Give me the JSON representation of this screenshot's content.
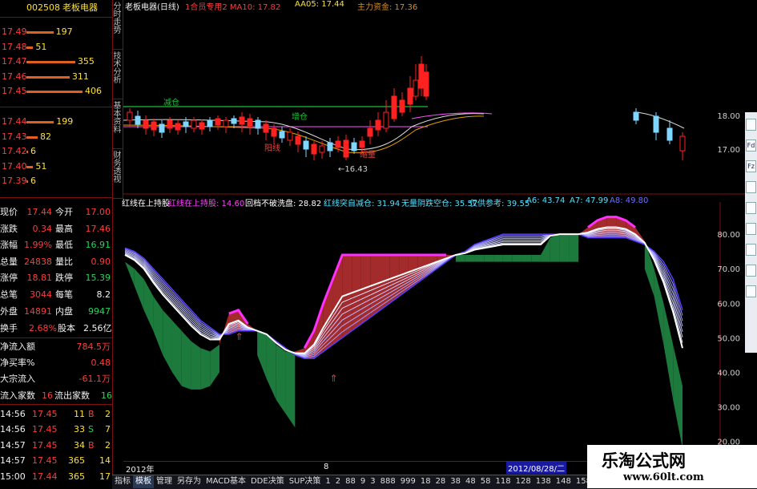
{
  "stock": {
    "code": "002508",
    "name": "老板电器"
  },
  "asks": [
    {
      "price": "17.49",
      "vol": "197",
      "bar": 0.48
    },
    {
      "price": "17.48",
      "vol": "51",
      "bar": 0.12
    },
    {
      "price": "17.47",
      "vol": "355",
      "bar": 0.87
    },
    {
      "price": "17.46",
      "vol": "311",
      "bar": 0.77
    },
    {
      "price": "17.45",
      "vol": "406",
      "bar": 1.0
    }
  ],
  "bids": [
    {
      "price": "17.44",
      "vol": "199",
      "bar": 0.49
    },
    {
      "price": "17.43",
      "vol": "82",
      "bar": 0.2
    },
    {
      "price": "17.42",
      "vol": "6",
      "bar": 0.02
    },
    {
      "price": "17.40",
      "vol": "51",
      "bar": 0.12
    },
    {
      "price": "17.39",
      "vol": "6",
      "bar": 0.02
    }
  ],
  "quote": [
    [
      "现价",
      "17.44",
      "今开",
      "17.00"
    ],
    [
      "涨跌",
      "0.34",
      "最高",
      "17.46"
    ],
    [
      "涨幅",
      "1.99%",
      "最低",
      "16.91"
    ],
    [
      "总量",
      "24838",
      "量比",
      "0.90"
    ],
    [
      "涨停",
      "18.81",
      "跌停",
      "15.39"
    ],
    [
      "总笔",
      "3044",
      "每笔",
      "8.2"
    ],
    [
      "外盘",
      "14891",
      "内盘",
      "9947"
    ]
  ],
  "turnover": {
    "l1": "换手",
    "v1": "2.68%",
    "l2": "股本",
    "v2": "2.56亿"
  },
  "flow": [
    {
      "label": "净流入额",
      "value": "784.5万"
    },
    {
      "label": "净买率%",
      "value": "0.48"
    },
    {
      "label": "大宗流入",
      "value": "-61.1万"
    }
  ],
  "counts": {
    "in_label": "流入家数",
    "in_val": "16",
    "out_label": "流出家数",
    "out_val": "16"
  },
  "ticks": [
    {
      "time": "14:56",
      "price": "17.45",
      "vol": "11",
      "side": "B",
      "n": "2"
    },
    {
      "time": "14:56",
      "price": "17.45",
      "vol": "33",
      "side": "S",
      "n": "7"
    },
    {
      "time": "14:57",
      "price": "17.45",
      "vol": "34",
      "side": "B",
      "n": "2"
    },
    {
      "time": "14:57",
      "price": "17.45",
      "vol": "365",
      "side": "",
      "n": "14"
    },
    {
      "time": "15:00",
      "price": "17.44",
      "vol": "365",
      "side": "",
      "n": "17"
    }
  ],
  "vtabs": [
    "分时走势",
    "技术分析",
    "基本资料",
    "财务透视"
  ],
  "main_header": {
    "title": "老板电器(日线)",
    "t1": "1合员专用2 MA10: 17.82",
    "t2": "AA05: 17.44",
    "t3": "主力资金: 17.36"
  },
  "main_labels": {
    "reduce": "减仓",
    "add": "增仓",
    "up_k": "阳线",
    "low": "16.43",
    "low2": "缩量",
    "ytick1": "18.00",
    "ytick2": "17.00"
  },
  "osc_header": [
    {
      "text": "红线在上持股",
      "color": "#ffffff"
    },
    {
      "text": "红线在上持股: 14.60",
      "color": "#ff40ff"
    },
    {
      "text": "回档不破洗盘: 28.82",
      "color": "#ffffff"
    },
    {
      "text": "红线突自减仓: 31.94",
      "color": "#56e0ff"
    },
    {
      "text": "无量阴跌空仓: 35.57",
      "color": "#56e0ff"
    },
    {
      "text": "仅供参考: 39.55",
      "color": "#56e0ff"
    },
    {
      "text": "A6: 43.74",
      "color": "#56e0ff"
    },
    {
      "text": "A7: 47.99",
      "color": "#56e0ff"
    },
    {
      "text": "A8: 49.80",
      "color": "#7070ff"
    }
  ],
  "osc_axis": [
    "80.00",
    "70.00",
    "60.00",
    "50.00",
    "40.00",
    "30.00",
    "20.00"
  ],
  "chart_data": {
    "type": "area",
    "ylim": [
      15,
      87
    ],
    "yticks": [
      80,
      70,
      60,
      50,
      40,
      30,
      20
    ],
    "x": [
      0,
      1,
      2,
      3,
      4,
      5,
      6,
      7,
      8,
      9,
      10,
      11,
      12,
      13,
      14,
      15,
      16,
      17,
      18,
      19,
      20,
      21,
      22,
      23,
      24,
      25,
      26,
      27,
      28,
      29,
      30,
      31,
      32,
      33,
      34,
      35,
      36,
      37,
      38,
      39,
      40,
      41,
      42,
      43,
      44,
      45,
      46,
      47,
      48,
      49,
      50,
      51,
      52,
      53,
      54,
      55,
      56,
      57,
      58,
      59
    ],
    "fast": [
      72,
      70,
      67,
      62,
      58,
      55,
      52,
      49,
      47,
      46,
      48,
      57,
      58,
      54,
      52,
      51,
      48,
      46,
      46,
      47,
      52,
      60,
      67,
      74,
      74,
      74,
      74,
      74,
      74,
      74,
      74,
      74,
      74,
      74,
      74,
      74,
      74,
      74,
      74,
      74,
      74,
      74,
      74,
      74,
      74,
      79,
      80,
      80,
      80,
      82,
      84,
      85,
      85,
      84,
      82,
      78,
      70,
      60,
      48,
      36
    ],
    "slow": [
      76,
      75,
      73,
      70,
      67,
      64,
      61,
      58,
      55,
      53,
      51,
      51,
      52,
      52,
      52,
      51,
      49,
      47,
      45,
      44,
      44,
      46,
      48,
      50,
      52,
      54,
      56,
      58,
      60,
      62,
      64,
      66,
      68,
      70,
      72,
      74,
      75,
      77,
      78,
      79,
      80,
      80,
      80,
      80,
      80,
      80,
      80,
      80,
      80,
      79,
      79,
      79,
      79,
      79,
      78,
      77,
      75,
      72,
      67,
      58
    ],
    "lower": [
      72,
      65,
      58,
      52,
      45,
      40,
      36,
      35,
      35,
      36,
      40,
      50,
      54,
      51,
      45,
      38,
      32,
      28,
      24,
      22,
      27,
      36,
      42,
      52,
      56,
      62,
      66,
      70,
      72,
      72,
      72,
      72,
      72,
      72,
      72,
      72,
      72,
      72,
      72,
      72,
      72,
      72,
      72,
      72,
      72,
      72,
      72,
      72,
      72,
      72,
      72,
      72,
      72,
      72,
      72,
      70,
      62,
      48,
      32,
      18
    ],
    "arrows": [
      12,
      22
    ]
  },
  "date_bar": {
    "year": "2012年",
    "mid": "8",
    "cursor": "2012/08/28/二"
  },
  "bottom_tabs": [
    "指标",
    "模板",
    "管理",
    "另存为",
    "MACD基本",
    "DDE决策",
    "SUP决策",
    "1",
    "2",
    "88",
    "9",
    "3",
    "888",
    "999",
    "18",
    "28",
    "38",
    "48",
    "58",
    "118",
    "128",
    "138",
    "148",
    "158",
    "168",
    "178",
    "188",
    "198",
    "8",
    "218",
    "228"
  ],
  "watermark": {
    "line1": "乐淘公式网",
    "line2": "www.60lt.com"
  },
  "toolbar": [
    "",
    "Fd",
    "Fz",
    "",
    "",
    "",
    "",
    "",
    ""
  ]
}
